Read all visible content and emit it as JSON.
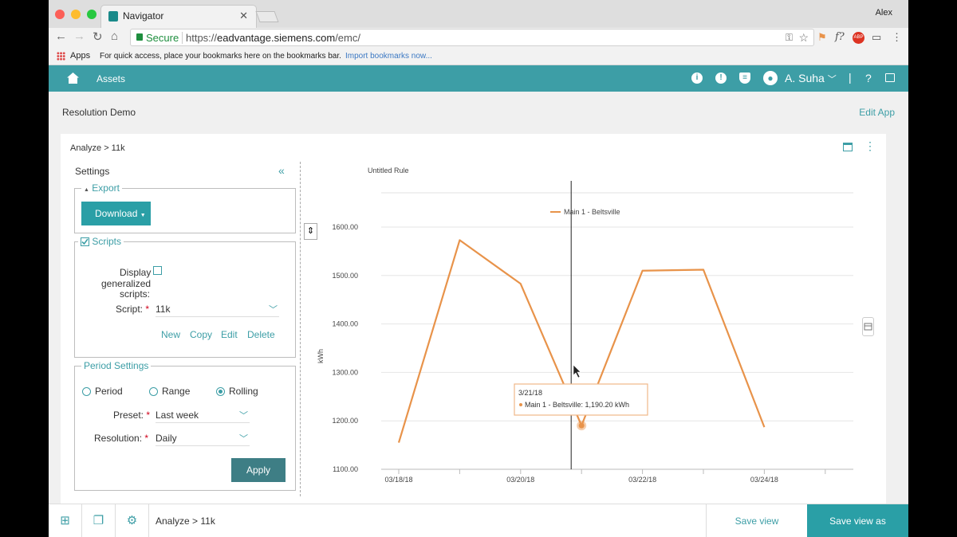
{
  "browser": {
    "tab_title": "Navigator",
    "user": "Alex",
    "secure_label": "Secure",
    "url_prefix": "https://",
    "url_domain": "eadvantage.siemens.com",
    "url_path": "/emc/",
    "bookmarks": {
      "apps": "Apps",
      "hint": "For quick access, place your bookmarks here on the bookmarks bar.",
      "import": "Import bookmarks now..."
    }
  },
  "app": {
    "nav_assets": "Assets",
    "user_name": "A. Suha",
    "sep": "|",
    "help": "?"
  },
  "page": {
    "title": "Resolution Demo",
    "edit_app": "Edit App",
    "breadcrumb": "Analyze > 11k"
  },
  "settings": {
    "title": "Settings",
    "collapse": "«",
    "export_legend": "Export",
    "download": "Download",
    "scripts_legend": "Scripts",
    "display_label1": "Display",
    "display_label2": "generalized",
    "display_label3": "scripts:",
    "script_label": "Script:",
    "script_value": "11k",
    "actions": [
      "New",
      "Copy",
      "Edit",
      "Delete"
    ],
    "period_legend": "Period Settings",
    "radios": [
      "Period",
      "Range",
      "Rolling"
    ],
    "preset_label": "Preset:",
    "preset_value": "Last week",
    "resolution_label": "Resolution:",
    "resolution_value": "Daily",
    "apply": "Apply"
  },
  "chart_data": {
    "type": "line",
    "title": "Untitled Rule",
    "ylabel": "kWh",
    "ylim": [
      1100,
      1600
    ],
    "yticks": [
      "1600.00",
      "1500.00",
      "1400.00",
      "1300.00",
      "1200.00",
      "1100.00"
    ],
    "x": [
      "03/18/18",
      "03/19/18",
      "03/20/18",
      "03/21/18",
      "03/22/18",
      "03/23/18",
      "03/24/18"
    ],
    "xtick_labels": [
      "03/18/18",
      "03/20/18",
      "03/22/18",
      "03/24/18"
    ],
    "series": [
      {
        "name": "Main 1 - Beltsville",
        "color": "#e8934a",
        "values": [
          1155,
          1573,
          1483,
          1190.2,
          1510,
          1512,
          1187
        ]
      }
    ],
    "tooltip": {
      "date": "3/21/18",
      "text": "Main 1 - Beltsville: 1,190.20 kWh"
    }
  },
  "bottom": {
    "breadcrumb": "Analyze > 11k",
    "save_view": "Save view",
    "save_view_as": "Save view as"
  }
}
